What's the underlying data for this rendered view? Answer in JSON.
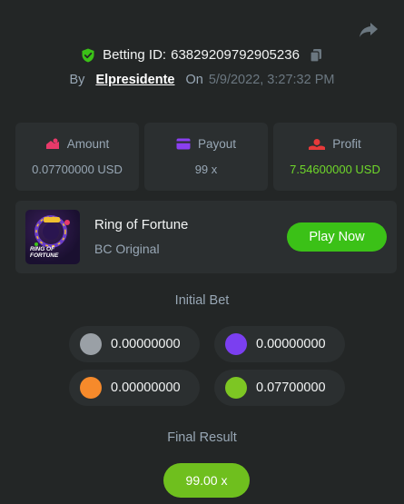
{
  "header": {
    "betting_id_label": "Betting ID:",
    "betting_id": "63829209792905236",
    "by_label": "By",
    "username": "Elpresidente",
    "on_label": "On",
    "date": "5/9/2022, 3:27:32 PM",
    "shield_icon": "shield-check-icon",
    "copy_icon": "copy-icon",
    "share_icon": "share-icon"
  },
  "stats": [
    {
      "label": "Amount",
      "value": "0.07700000 USD",
      "icon": "amount-icon",
      "color": "#e83a6a"
    },
    {
      "label": "Payout",
      "value": "99 x",
      "icon": "payout-icon",
      "color": "#8a3ff0"
    },
    {
      "label": "Profit",
      "value": "7.54600000 USD",
      "icon": "profit-icon",
      "color": "#e83a3a"
    }
  ],
  "game": {
    "title": "Ring of Fortune",
    "subtitle": "BC Original",
    "thumb_text_line1": "RING OF",
    "thumb_text_line2": "FORTUNE",
    "play_label": "Play Now"
  },
  "initial_bet": {
    "title": "Initial Bet",
    "bets": [
      {
        "value": "0.00000000",
        "color": "#9aa0a6"
      },
      {
        "value": "0.00000000",
        "color": "#7b3ff0"
      },
      {
        "value": "0.00000000",
        "color": "#f68a2b"
      },
      {
        "value": "0.07700000",
        "color": "#7dc623"
      }
    ]
  },
  "final_result": {
    "title": "Final Result",
    "value": "99.00 x"
  },
  "colors": {
    "background": "#232626",
    "card": "#2b2f30",
    "accent_green": "#3bc117",
    "profit_green": "#6fd82a"
  }
}
